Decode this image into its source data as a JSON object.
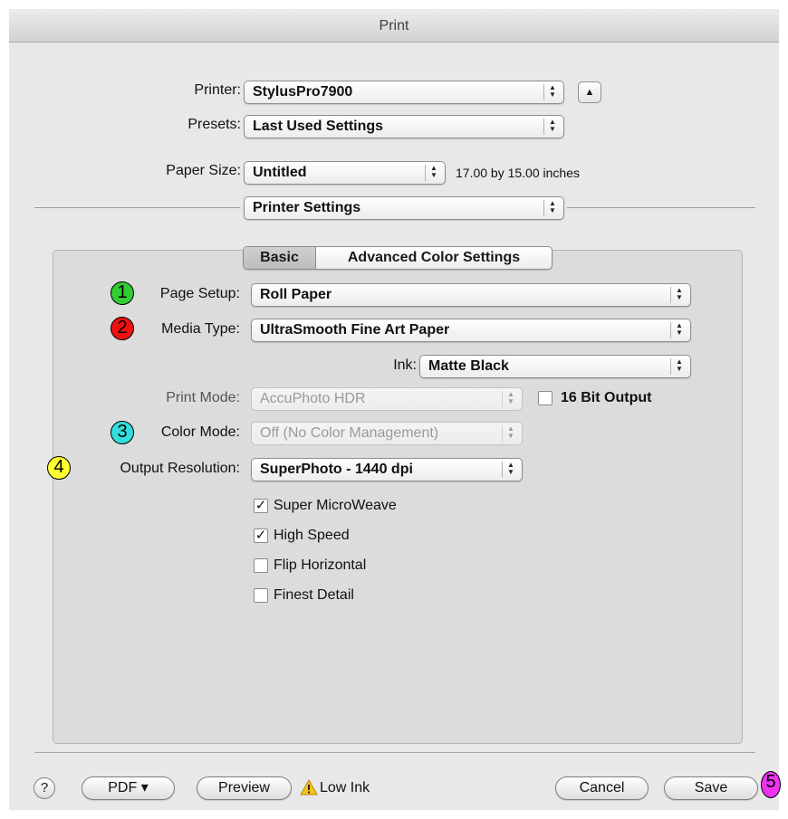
{
  "window": {
    "title": "Print"
  },
  "printer": {
    "label": "Printer:",
    "value": "StylusPro7900"
  },
  "presets": {
    "label": "Presets:",
    "value": "Last Used Settings"
  },
  "paper_size": {
    "label": "Paper Size:",
    "value": "Untitled",
    "dimensions": "17.00 by 15.00 inches"
  },
  "panel": {
    "value": "Printer Settings"
  },
  "tabs": [
    {
      "label": "Basic",
      "selected": true
    },
    {
      "label": "Advanced Color Settings",
      "selected": false
    }
  ],
  "settings": {
    "page_setup": {
      "label": "Page Setup:",
      "value": "Roll Paper"
    },
    "media_type": {
      "label": "Media Type:",
      "value": "UltraSmooth Fine Art Paper"
    },
    "ink": {
      "label": "Ink:",
      "value": "Matte Black"
    },
    "print_mode": {
      "label": "Print Mode:",
      "value": "AccuPhoto HDR",
      "disabled": true
    },
    "bit_output": {
      "label": "16 Bit Output",
      "checked": false
    },
    "color_mode": {
      "label": "Color Mode:",
      "value": "Off (No Color Management)",
      "disabled": true
    },
    "output_resolution": {
      "label": "Output Resolution:",
      "value": "SuperPhoto - 1440 dpi"
    }
  },
  "checkboxes": [
    {
      "label": "Super MicroWeave",
      "checked": true
    },
    {
      "label": "High Speed",
      "checked": true
    },
    {
      "label": "Flip Horizontal",
      "checked": false
    },
    {
      "label": "Finest Detail",
      "checked": false
    }
  ],
  "check_glyph": "✓",
  "markers": [
    {
      "number": "1",
      "color": "#33cc33"
    },
    {
      "number": "2",
      "color": "#ee1111"
    },
    {
      "number": "3",
      "color": "#33dddd"
    },
    {
      "number": "4",
      "color": "#ffff33"
    },
    {
      "number": "5",
      "color": "#ee33ee"
    }
  ],
  "footer": {
    "help": "?",
    "pdf": "PDF ▾",
    "preview": "Preview",
    "low_ink": "Low Ink",
    "cancel": "Cancel",
    "save": "Save"
  },
  "icons": {
    "disclosure": "▲",
    "popup_arrows": "▲▼",
    "warning": "warning-triangle-icon"
  }
}
